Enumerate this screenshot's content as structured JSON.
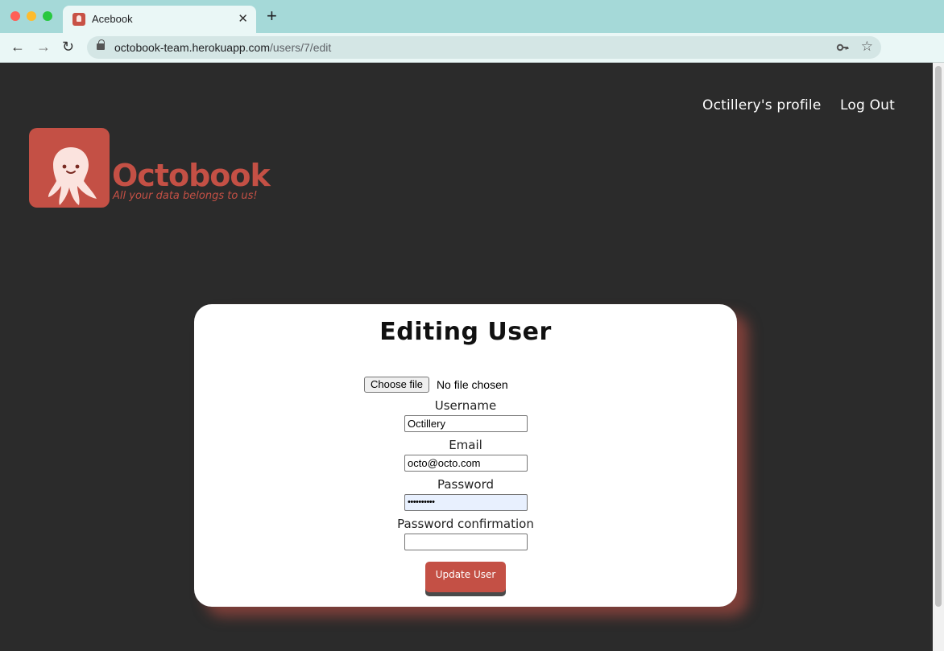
{
  "browser": {
    "tab_title": "Acebook",
    "tab_close": "✕",
    "new_tab": "+",
    "url_host": "octobook-team.herokuapp.com",
    "url_path": "/users/7/edit",
    "nav": {
      "back": "←",
      "forward": "→",
      "reload": "↻"
    },
    "icons": [
      "lock-icon",
      "key-icon",
      "star-icon",
      "avatar",
      "menu-dots-icon"
    ]
  },
  "header": {
    "profile_link": "Octillery's profile",
    "logout_link": "Log Out"
  },
  "logo": {
    "wordmark": "Octobook",
    "tagline": "All your data belongs to us!",
    "color": "#c45045"
  },
  "form": {
    "title": "Editing User",
    "file_button": "Choose file",
    "file_status": "No file chosen",
    "username_label": "Username",
    "username_value": "Octillery",
    "email_label": "Email",
    "email_value": "octo@octo.com",
    "password_label": "Password",
    "password_value": "••••••••••",
    "password_confirmation_label": "Password confirmation",
    "password_confirmation_value": "",
    "submit_label": "Update User"
  }
}
